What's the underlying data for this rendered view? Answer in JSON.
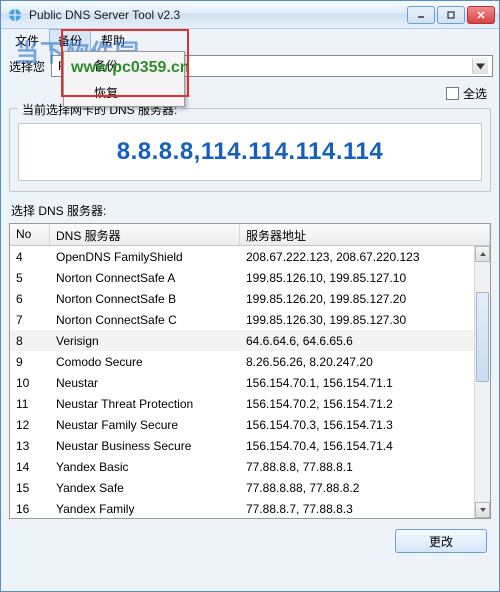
{
  "window": {
    "title": "Public DNS Server Tool v2.3"
  },
  "menubar": {
    "file": "文件",
    "backup": "备份",
    "help": "帮助"
  },
  "dropdown": {
    "backup": "备份",
    "restore": "恢复"
  },
  "watermark": {
    "main": "当下软件园",
    "url": "www.pc0359.cn"
  },
  "adapter": {
    "label": "选择您",
    "selected": "Realte                                                    btroller"
  },
  "select_all": "全选",
  "current_group_title": "当前选择网卡的 DNS 服务器:",
  "current_dns": "8.8.8.8,114.114.114.114",
  "list_title": "选择 DNS 服务器:",
  "columns": {
    "no": "No",
    "name": "DNS 服务器",
    "addr": "服务器地址"
  },
  "rows": [
    {
      "no": "4",
      "name": "OpenDNS FamilyShield",
      "addr": "208.67.222.123, 208.67.220.123"
    },
    {
      "no": "5",
      "name": "Norton ConnectSafe A",
      "addr": "199.85.126.10, 199.85.127.10"
    },
    {
      "no": "6",
      "name": "Norton ConnectSafe B",
      "addr": "199.85.126.20, 199.85.127.20"
    },
    {
      "no": "7",
      "name": "Norton ConnectSafe C",
      "addr": "199.85.126.30, 199.85.127.30"
    },
    {
      "no": "8",
      "name": "Verisign",
      "addr": "64.6.64.6, 64.6.65.6",
      "selected": true
    },
    {
      "no": "9",
      "name": "Comodo Secure",
      "addr": "8.26.56.26, 8.20.247.20"
    },
    {
      "no": "10",
      "name": "Neustar",
      "addr": "156.154.70.1, 156.154.71.1"
    },
    {
      "no": "11",
      "name": "Neustar Threat Protection",
      "addr": "156.154.70.2, 156.154.71.2"
    },
    {
      "no": "12",
      "name": "Neustar Family Secure",
      "addr": "156.154.70.3, 156.154.71.3"
    },
    {
      "no": "13",
      "name": "Neustar Business Secure",
      "addr": "156.154.70.4, 156.154.71.4"
    },
    {
      "no": "14",
      "name": "Yandex Basic",
      "addr": "77.88.8.8, 77.88.8.1"
    },
    {
      "no": "15",
      "name": "Yandex Safe",
      "addr": "77.88.8.88, 77.88.8.2"
    },
    {
      "no": "16",
      "name": "Yandex Family",
      "addr": "77.88.8.7, 77.88.8.3"
    }
  ],
  "change_btn": "更改"
}
